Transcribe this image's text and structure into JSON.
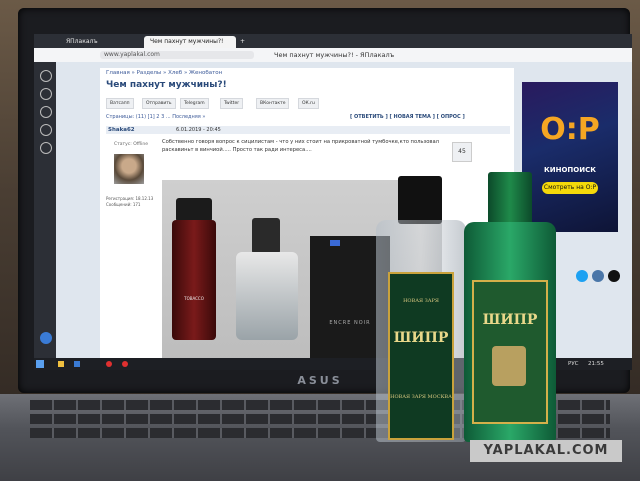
{
  "browser": {
    "tabs": [
      "ЯПлакалъ",
      "Чем пахнут мужчины?!",
      ""
    ],
    "address": "www.yaplakal.com",
    "page_title": "Чем пахнут мужчины?! - ЯПлакалъ"
  },
  "forum": {
    "breadcrumb": "Главная » Разделы » Хлеб » Женобатон",
    "topic_title": "Чем пахнут мужчины?!",
    "share_buttons": [
      "Ватсапп",
      "Отправить",
      "Telegram",
      "Twitter",
      "ВКонтакте",
      "ОК.ru"
    ],
    "pages": "Страницы: (11) [1] 2 3 ... Последняя »",
    "actions": "[ ОТВЕТИТЬ ] [ НОВАЯ ТЕМА ] [ ОПРОС ]",
    "author": "Shaka62",
    "post_date": "6.01.2019 - 20:45",
    "status": "Статус: Offline",
    "reg_info": [
      "Регистрация: 18.12.13",
      "Сообщений: 171"
    ],
    "post_text": "Собственно говоря вопрос к сицилистам - что у них стоит на прикроватной тумбочке,кто пользовал раскавиньт в винчиой..... Просто так ради интереса....",
    "rating": "45"
  },
  "ad": {
    "big_text": "О:Р",
    "name": "КИНОПОИСК",
    "button": "Смотреть на О:Р"
  },
  "taskbar": {
    "lang": "РУС",
    "time": "21:55"
  },
  "photo_labels": {
    "bottle1": "TOBACCO",
    "box": "ENCRE NOIR"
  },
  "bottles": {
    "left": {
      "brand": "НОВАЯ ЗАРЯ",
      "title": "ШИПР",
      "sub": "НОВАЯ ЗАРЯ МОСКВА"
    },
    "right": {
      "title": "ШИПР"
    }
  },
  "laptop_brand": "ASUS",
  "watermark": "YAPLAKAL.COM",
  "colors": {
    "bottle_label": "#0f3a22",
    "label_gold": "#c9a23c",
    "ad_accent": "#f5a623"
  }
}
